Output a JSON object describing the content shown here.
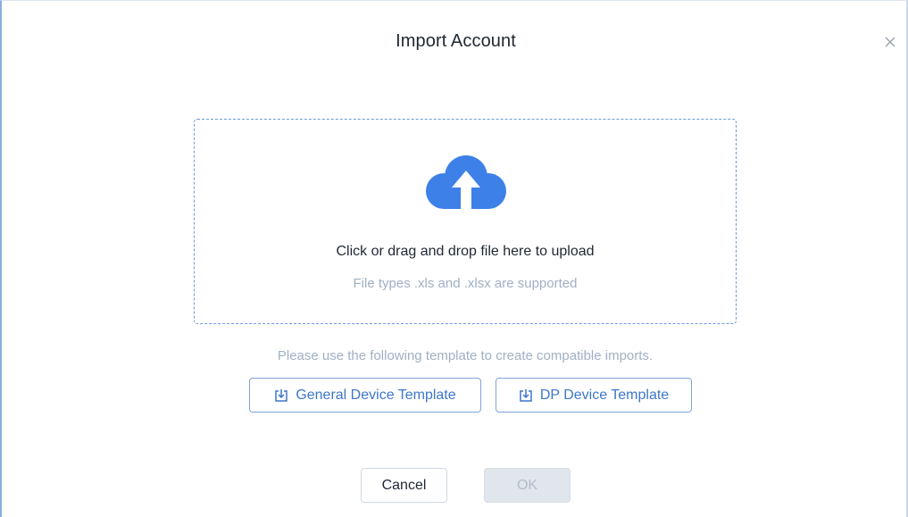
{
  "dialog": {
    "title": "Import Account",
    "close_icon": "close-icon"
  },
  "upload": {
    "icon": "cloud-upload-icon",
    "main_text": "Click or drag and drop file here to upload",
    "sub_text": "File types .xls and .xlsx are supported"
  },
  "templates": {
    "hint": "Please use the following template to create compatible imports.",
    "general_label": "General Device Template",
    "dp_label": "DP Device Template",
    "icon": "download-icon"
  },
  "footer": {
    "cancel_label": "Cancel",
    "ok_label": "OK",
    "ok_disabled": true
  },
  "colors": {
    "accent": "#3d80e8",
    "link": "#3d77c9",
    "muted_text": "#9fb0c3",
    "disabled_bg": "#e1e6ec"
  }
}
